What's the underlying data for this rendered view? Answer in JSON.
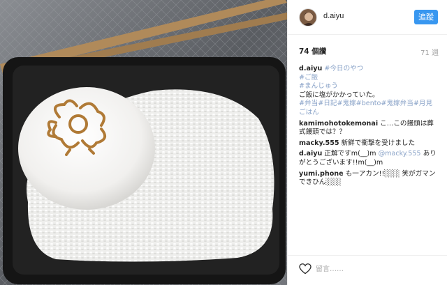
{
  "post": {
    "photo_description_icon": "food-photo",
    "username": "d.aiyu",
    "follow_label": "追蹤",
    "likes": "74 個讚",
    "time": "71 週",
    "caption": {
      "user": "d.aiyu",
      "lines": [
        "#今日のやつ",
        "#ご飯",
        "#まんじゅう",
        "ご飯に塩がかかっていた。",
        "#弁当#日記#鬼嫁#bento#鬼嫁弁当#月見ごはん"
      ]
    },
    "comments": [
      {
        "user": "kamimohotokemonai",
        "text": "こ…この饅頭は葬式饅頭では？？"
      },
      {
        "user": "macky.555",
        "text": "新鮮で衝撃を受けました"
      },
      {
        "user": "d.aiyu",
        "text": "正解ですm(__)m ",
        "mention": "@macky.555",
        "text2": "ありがとうございます!!m(__)m"
      },
      {
        "user": "yumi.phone",
        "text": "も一アカン!!░░░ 笑がガマンできひん░░░"
      }
    ],
    "comment_placeholder": "留言……",
    "colors": {
      "accent": "#3897f0",
      "hashtag": "#8aa3c8"
    }
  }
}
